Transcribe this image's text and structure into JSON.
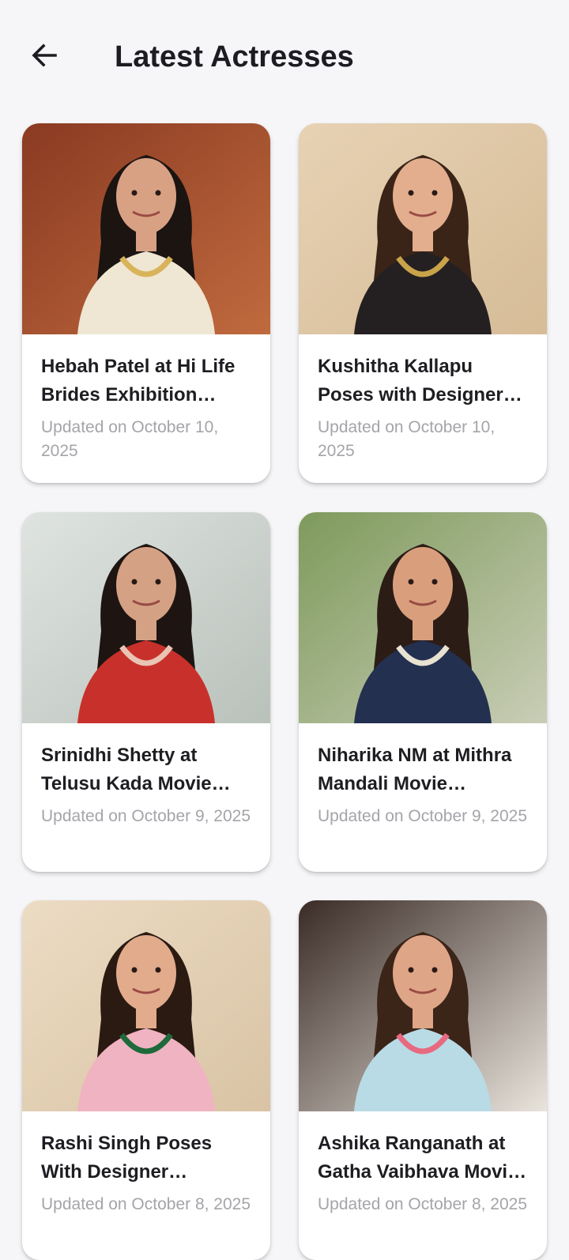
{
  "header": {
    "title": "Latest Actresses",
    "back_icon": "arrow-left-icon"
  },
  "cards": [
    {
      "title": "Hebah Patel at Hi Life Brides Exhibition Launch",
      "date": "Updated on October 10, 2025",
      "palette": {
        "bg1": "#8a3a22",
        "bg2": "#c06a3e",
        "hair": "#1b1411",
        "skin": "#d9a184",
        "outfit": "#efe6d3",
        "accent": "#d8b35a"
      }
    },
    {
      "title": "Kushitha Kallapu Poses with Designer Jewellery",
      "date": "Updated on October 10, 2025",
      "palette": {
        "bg1": "#e7d2b4",
        "bg2": "#d6bc97",
        "hair": "#3a2417",
        "skin": "#e2ae8e",
        "outfit": "#242021",
        "accent": "#c9a34a"
      }
    },
    {
      "title": "Srinidhi Shetty at Telusu Kada Movie Interview",
      "date": "Updated on October 9, 2025",
      "palette": {
        "bg1": "#dfe4e0",
        "bg2": "#b9c1bb",
        "hair": "#1e1512",
        "skin": "#d5a184",
        "outfit": "#c8312b",
        "accent": "#e9c4b4"
      }
    },
    {
      "title": "Niharika NM at Mithra Mandali Movie Interview",
      "date": "Updated on October 9, 2025",
      "palette": {
        "bg1": "#7e9a5c",
        "bg2": "#c9cdb6",
        "hair": "#2c1c16",
        "skin": "#d99f7d",
        "outfit": "#23304f",
        "accent": "#e8e2d2"
      }
    },
    {
      "title": "Rashi Singh Poses With Designer Jewellery",
      "date": "Updated on October 8, 2025",
      "palette": {
        "bg1": "#ecdcc4",
        "bg2": "#d9c3a4",
        "hair": "#2a1a12",
        "skin": "#e1ab8c",
        "outfit": "#f0b3c1",
        "accent": "#1f6a3b"
      }
    },
    {
      "title": "Ashika Ranganath at Gatha Vaibhava Movie Event",
      "date": "Updated on October 8, 2025",
      "palette": {
        "bg1": "#3a2b26",
        "bg2": "#e9e4dc",
        "hair": "#3b2418",
        "skin": "#dfa587",
        "outfit": "#b9dbe6",
        "accent": "#e86a80"
      }
    }
  ]
}
